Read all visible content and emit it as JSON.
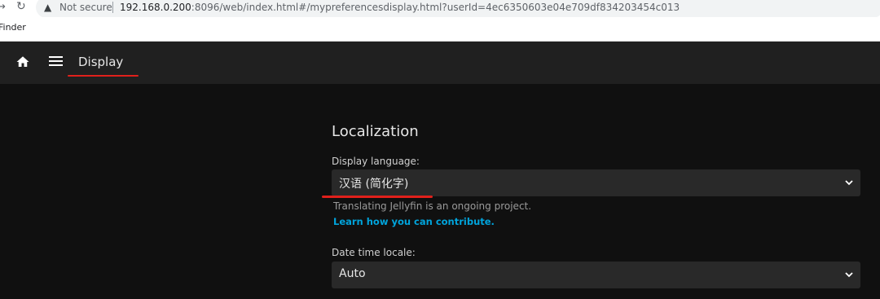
{
  "browser": {
    "security_label": "Not secure",
    "url_host": "192.168.0.200",
    "url_rest": ":8096/web/index.html#/mypreferencesdisplay.html?userId=4ec6350603e04e709df834203454c013",
    "bookmark": "Finder"
  },
  "app": {
    "page_title": "Display",
    "section_title": "Localization",
    "display_language": {
      "label": "Display language:",
      "value": "汉语 (简化字)",
      "hint": "Translating Jellyfin is an ongoing project.",
      "link": "Learn how you can contribute."
    },
    "date_time_locale": {
      "label": "Date time locale:",
      "value": "Auto"
    }
  },
  "colors": {
    "accent_link": "#00a4dc",
    "annotation_red": "#e0201b",
    "app_bg": "#101010",
    "header_bg": "#202020"
  }
}
